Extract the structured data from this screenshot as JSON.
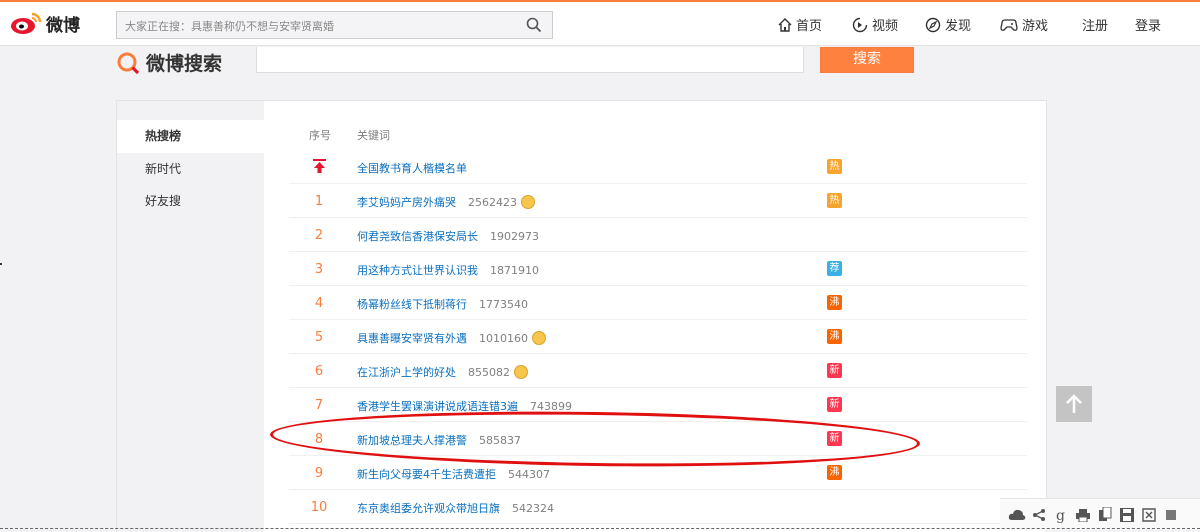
{
  "brand": {
    "name": "微博",
    "search_logo_text": "微博搜索"
  },
  "topbar": {
    "search_placeholder": "大家正在搜：具惠善称仍不想与安宰贤离婚",
    "nav": [
      {
        "label": "首页",
        "icon": "home-icon"
      },
      {
        "label": "视频",
        "icon": "video-icon"
      },
      {
        "label": "发现",
        "icon": "discover-icon"
      },
      {
        "label": "游戏",
        "icon": "game-icon"
      },
      {
        "label": "注册",
        "icon": ""
      },
      {
        "label": "登录",
        "icon": ""
      }
    ]
  },
  "search": {
    "button_label": "搜索",
    "value": ""
  },
  "sidebar": {
    "items": [
      {
        "label": "热搜榜",
        "active": true
      },
      {
        "label": "新时代",
        "active": false
      },
      {
        "label": "好友搜",
        "active": false
      }
    ]
  },
  "table": {
    "headers": {
      "rank": "序号",
      "keyword": "关键词"
    },
    "rows": [
      {
        "rank": "",
        "keyword": "全国教书育人楷模名单",
        "count": "",
        "emoji": false,
        "badge": "热",
        "badge_color": "#f7a42e"
      },
      {
        "rank": "1",
        "keyword": "李艾妈妈产房外痛哭",
        "count": "2562423",
        "emoji": true,
        "badge": "热",
        "badge_color": "#f7a42e"
      },
      {
        "rank": "2",
        "keyword": "何君尧致信香港保安局长",
        "count": "1902973",
        "emoji": false,
        "badge": "",
        "badge_color": ""
      },
      {
        "rank": "3",
        "keyword": "用这种方式让世界认识我",
        "count": "1871910",
        "emoji": false,
        "badge": "荐",
        "badge_color": "#3ab0e8"
      },
      {
        "rank": "4",
        "keyword": "杨幂粉丝线下抵制蒋行",
        "count": "1773540",
        "emoji": false,
        "badge": "沸",
        "badge_color": "#f86400"
      },
      {
        "rank": "5",
        "keyword": "具惠善曝安宰贤有外遇",
        "count": "1010160",
        "emoji": true,
        "badge": "沸",
        "badge_color": "#f86400"
      },
      {
        "rank": "6",
        "keyword": "在江浙沪上学的好处",
        "count": "855082",
        "emoji": true,
        "badge": "新",
        "badge_color": "#ff3852"
      },
      {
        "rank": "7",
        "keyword": "香港学生罢课演讲说成语连错3遍",
        "count": "743899",
        "emoji": false,
        "badge": "新",
        "badge_color": "#ff3852"
      },
      {
        "rank": "8",
        "keyword": "新加坡总理夫人撑港警",
        "count": "585837",
        "emoji": false,
        "badge": "新",
        "badge_color": "#ff3852"
      },
      {
        "rank": "9",
        "keyword": "新生向父母要4千生活费遭拒",
        "count": "544307",
        "emoji": false,
        "badge": "沸",
        "badge_color": "#f86400"
      },
      {
        "rank": "10",
        "keyword": "东京奥组委允许观众带旭日旗",
        "count": "542324",
        "emoji": false,
        "badge": "",
        "badge_color": ""
      }
    ]
  },
  "colors": {
    "accent": "#fa7d3c",
    "search_button": "#ff8140",
    "link": "#0a6fbf",
    "highlight": "#e01010"
  }
}
